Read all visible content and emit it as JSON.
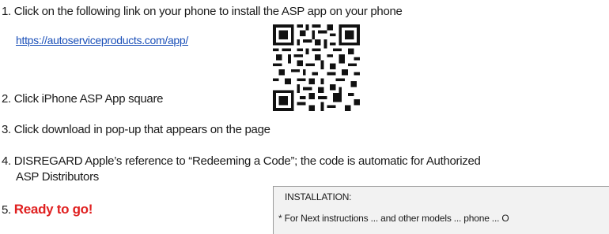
{
  "steps": {
    "s1": "1. Click on the following link on your phone to install the ASP app on your phone",
    "link": "https://autoserviceproducts.com/app/",
    "s2": "2. Click iPhone ASP App square",
    "s3": "3. Click download in pop-up that appears on the page",
    "s4_line1": "4. DISREGARD Apple’s reference to “Redeeming a Code”; the code is automatic for Authorized",
    "s4_line2": "ASP Distributors",
    "s5_number": "5. ",
    "s5_text": "Ready to go!"
  },
  "installation": {
    "title": "INSTALLATION:",
    "text": "* For Next instructions ... and other models ... phone ... O"
  },
  "colors": {
    "link": "#1a4fb8",
    "ready": "#e02020",
    "box_bg": "#f2f2f2"
  },
  "icons": {
    "qr": "qr-code-icon"
  }
}
